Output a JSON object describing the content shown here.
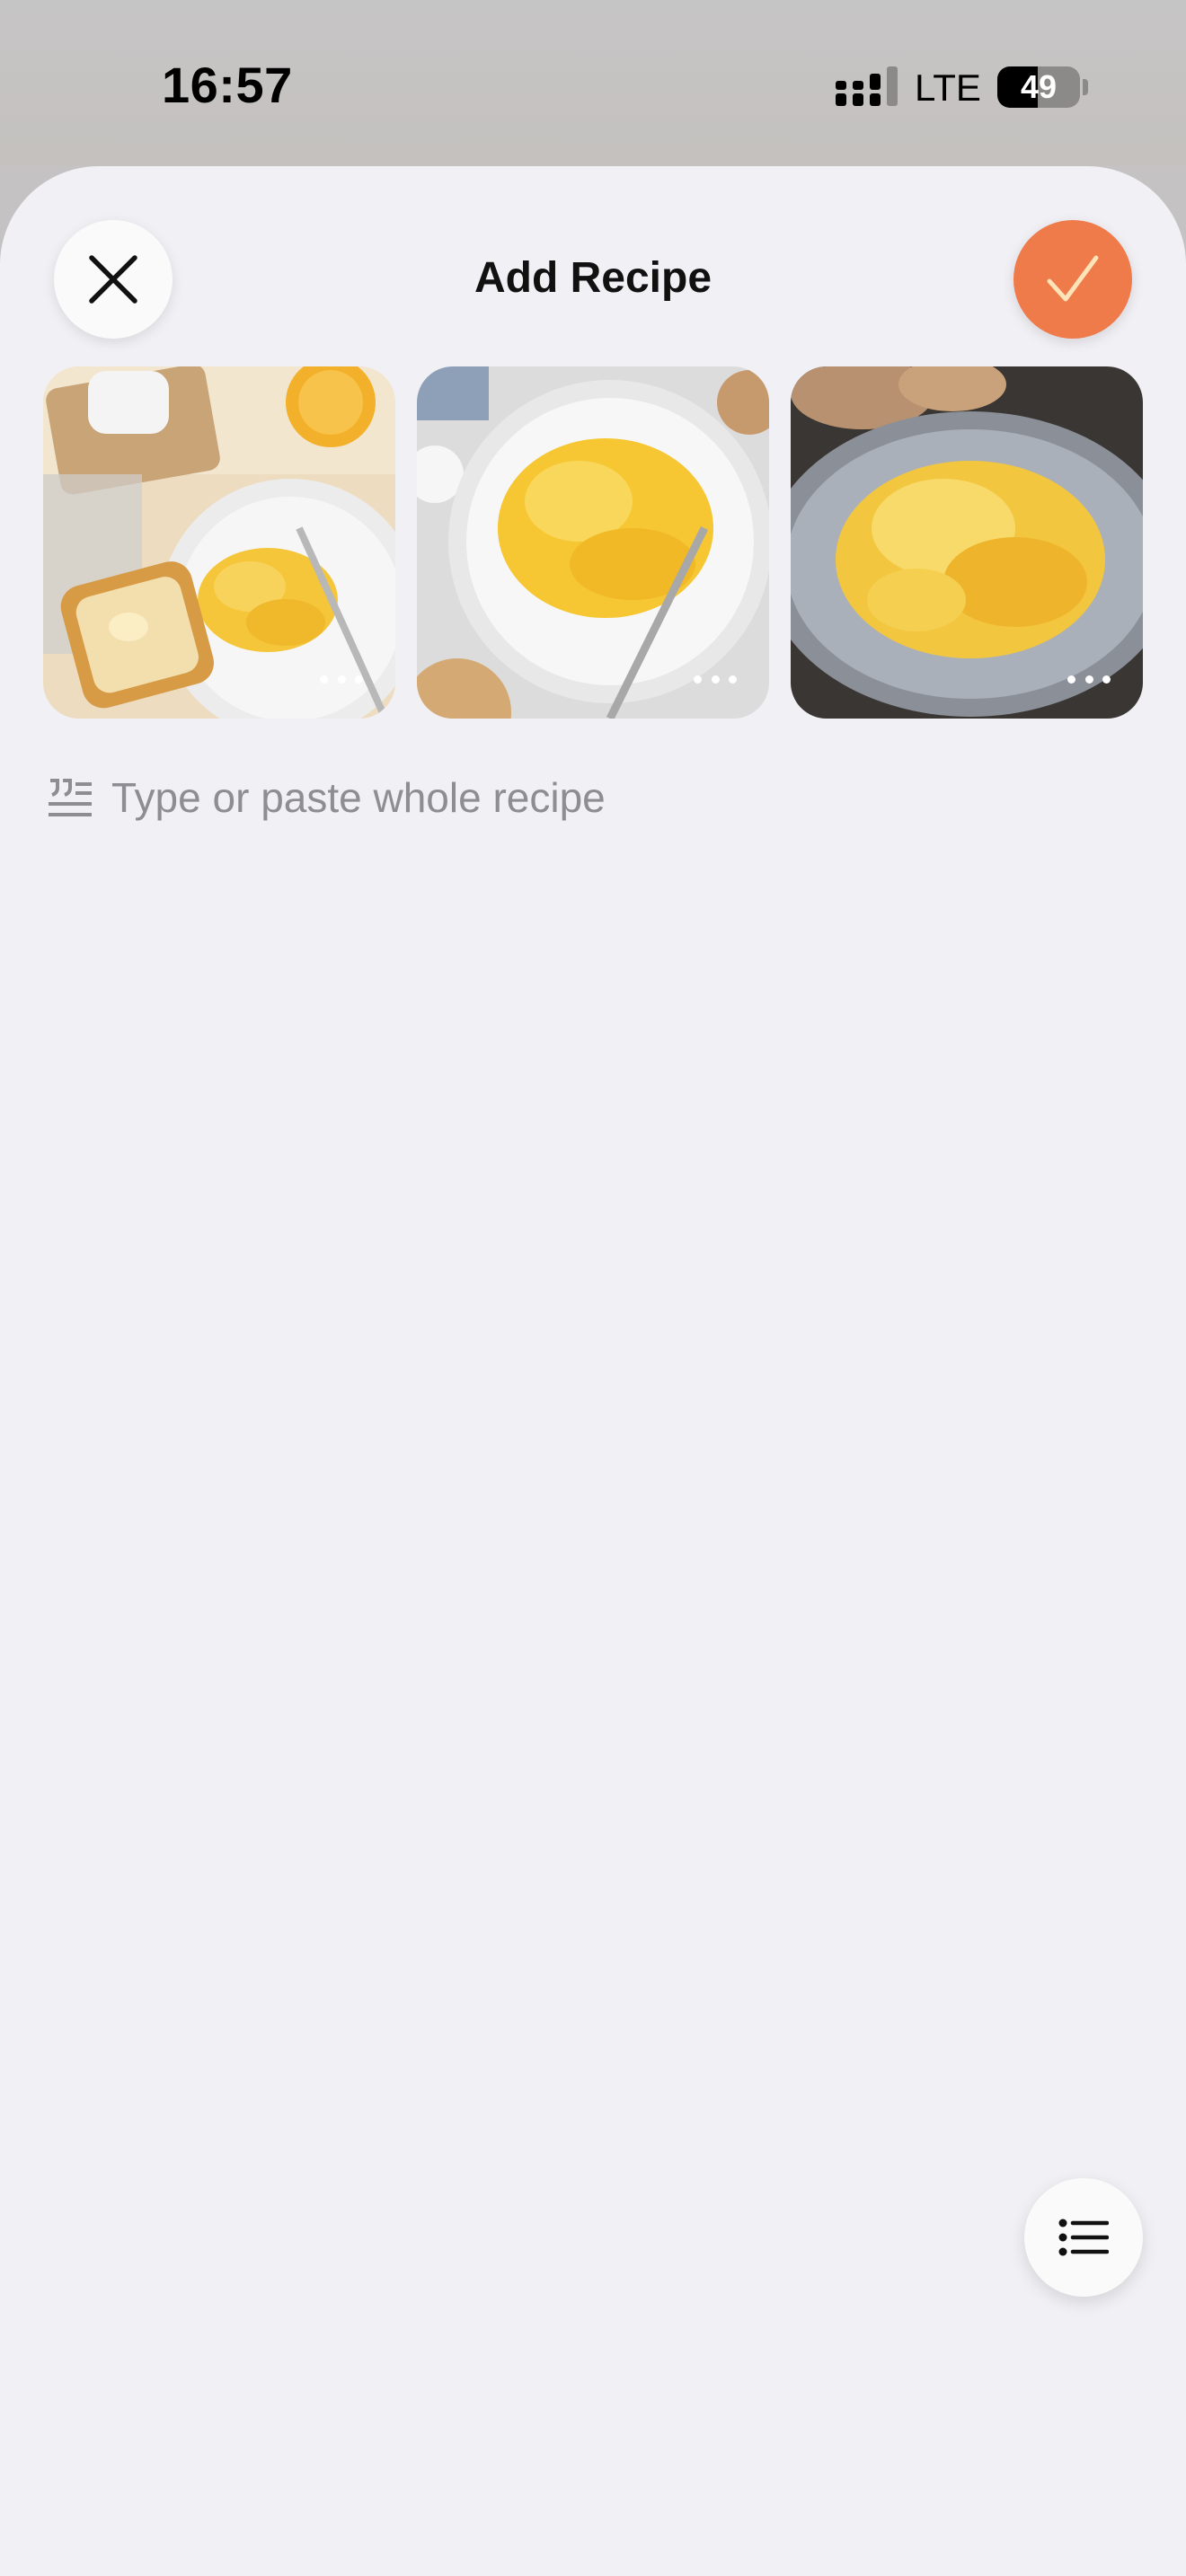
{
  "status_bar": {
    "time": "16:57",
    "network": "LTE",
    "battery_level": "49",
    "signal_icon": "cellular-signal-icon"
  },
  "header": {
    "title": "Add Recipe",
    "close_icon": "close-icon",
    "confirm_icon": "checkmark-icon"
  },
  "photos": [
    {
      "name": "photo-scrambled-eggs-with-toast",
      "menu_icon": "more-dots-icon"
    },
    {
      "name": "photo-scrambled-eggs-white-plate",
      "menu_icon": "more-dots-icon"
    },
    {
      "name": "photo-scrambled-eggs-gray-plate",
      "menu_icon": "more-dots-icon"
    }
  ],
  "recipe_input": {
    "placeholder": "Type or paste whole recipe",
    "icon": "paste-text-icon"
  },
  "floating_button": {
    "icon": "list-icon"
  },
  "colors": {
    "accent": "#ef7a4a",
    "sheet_background": "#f1f0f5",
    "placeholder_text": "#8e8d93"
  }
}
